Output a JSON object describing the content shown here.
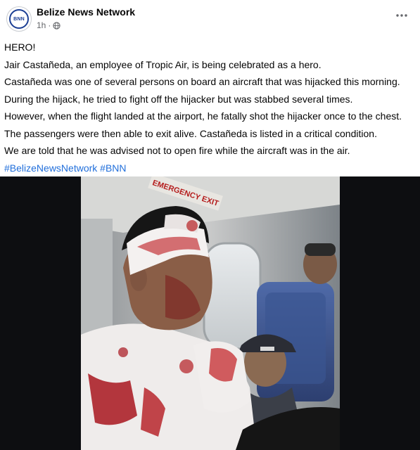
{
  "post": {
    "page_name": "Belize News Network",
    "timestamp": "1h",
    "separator": "·",
    "avatar_text": "BNN",
    "icons": {
      "audience": "globe-icon",
      "menu": "more-options-icon"
    },
    "body_lines": [
      "HERO!",
      "Jair Castañeda, an employee of Tropic Air, is being celebrated as a hero.",
      "Castañeda was one of several persons on board an aircraft that was hijacked this morning.",
      "During the hijack, he tried to fight off the hijacker but was stabbed several times.",
      "However, when the flight landed at the airport, he fatally shot the hijacker once to the chest.",
      "The passengers were then able to exit alive. Castañeda is listed in a critical condition.",
      "We are told that he was advised not to open fire while the aircraft was in the air."
    ],
    "hashtags": "#BelizeNewsNetwork #BNN",
    "photo": {
      "sign_text": "EMERGENCY EXIT"
    }
  },
  "colors": {
    "text": "#050505",
    "meta": "#65676b",
    "hashtag": "#216fdb",
    "photo_bg": "#0d0e11"
  }
}
